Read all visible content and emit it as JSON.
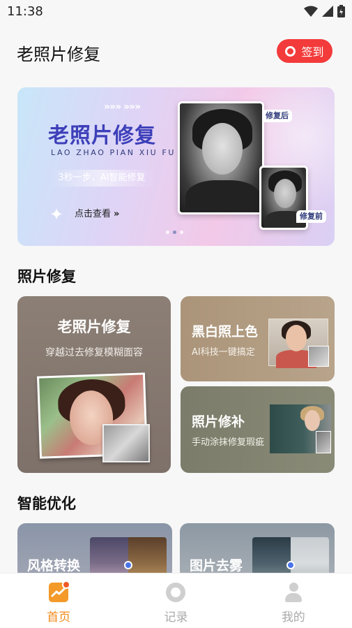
{
  "status_bar": {
    "time": "11:38"
  },
  "header": {
    "title": "老照片修复",
    "checkin_label": "签到"
  },
  "banner": {
    "chevrons": "»»» »»»",
    "title": "老照片修复",
    "pinyin": "LAO ZHAO PIAN XIU FU",
    "tagline": "3秒一步，AI智能修复",
    "cta": "点击查看",
    "cta_arrow": "»",
    "tag_after": "修复后",
    "tag_before": "修复前"
  },
  "section_repair": {
    "title": "照片修复",
    "cards": [
      {
        "title": "老照片修复",
        "subtitle": "穿越过去修复模糊面容"
      },
      {
        "title": "黑白照上色",
        "subtitle": "AI科技一键搞定"
      },
      {
        "title": "照片修补",
        "subtitle": "手动涂抹修复瑕疵"
      }
    ]
  },
  "section_optimize": {
    "title": "智能优化",
    "cards": [
      {
        "title": "风格转换"
      },
      {
        "title": "图片去雾"
      }
    ]
  },
  "bottom_nav": [
    {
      "label": "首页",
      "active": true
    },
    {
      "label": "记录",
      "active": false
    },
    {
      "label": "我的",
      "active": false
    }
  ],
  "colors": {
    "accent_red": "#f33b3b",
    "banner_title": "#3d3fb9",
    "nav_active": "#f08b1c",
    "nav_inactive": "#aaaaaa"
  }
}
